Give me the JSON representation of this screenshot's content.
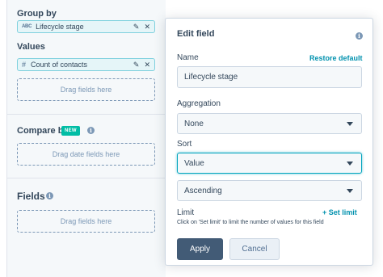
{
  "left_panel": {
    "group_by": {
      "label": "Group by",
      "pill": {
        "type_glyph": "ABC",
        "label": "Lifecycle stage"
      }
    },
    "values": {
      "label": "Values",
      "pill": {
        "type_glyph": "#",
        "label": "Count of contacts"
      },
      "dropzone": "Drag fields here"
    },
    "compare_by": {
      "label": "Compare by",
      "badge": "NEW",
      "dropzone": "Drag date fields here"
    },
    "fields": {
      "label": "Fields",
      "dropzone": "Drag fields here"
    }
  },
  "edit_field": {
    "title": "Edit field",
    "name_label": "Name",
    "restore_link": "Restore default",
    "name_value": "Lifecycle stage",
    "aggregation_label": "Aggregation",
    "aggregation_value": "None",
    "sort_label": "Sort",
    "sort_value": "Value",
    "order_value": "Ascending",
    "limit_label": "Limit",
    "set_limit_link": "+ Set limit",
    "limit_help": "Click on 'Set limit' to limit the number of values for this field",
    "apply_label": "Apply",
    "cancel_label": "Cancel"
  },
  "icons": {
    "edit": "pencil-icon",
    "remove": "close-icon",
    "info": "info-icon",
    "dropdown": "caret-down-icon"
  },
  "colors": {
    "accent_teal": "#00a4bd",
    "link": "#0091ae",
    "badge": "#00bda5",
    "primary_button": "#425b76",
    "text": "#33475b"
  }
}
